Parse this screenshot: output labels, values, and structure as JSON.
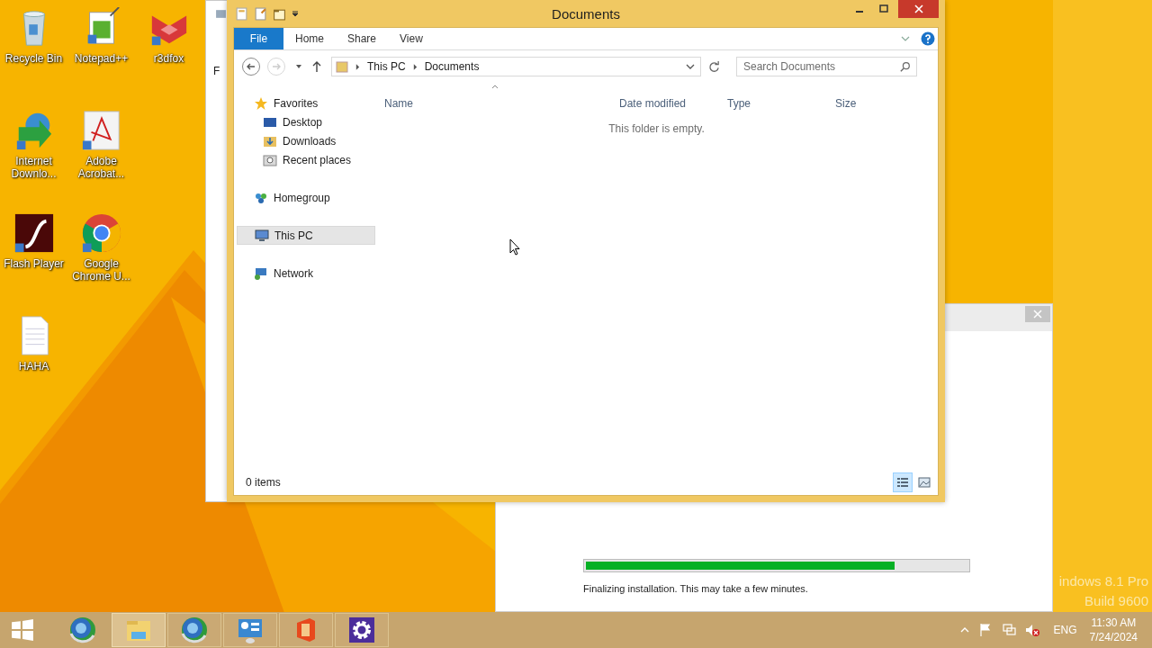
{
  "desktop": {
    "icon_rows": [
      [
        {
          "label": "Recycle Bin",
          "kind": "bin"
        },
        {
          "label": "Notepad++",
          "kind": "notepad"
        },
        {
          "label": "r3dfox",
          "kind": "fox"
        }
      ],
      [
        {
          "label": "Internet Downlo...",
          "kind": "download"
        },
        {
          "label": "Adobe Acrobat...",
          "kind": "pdf"
        }
      ],
      [
        {
          "label": "Flash Player",
          "kind": "flash"
        },
        {
          "label": "Google Chrome U...",
          "kind": "chrome"
        }
      ],
      [
        {
          "label": "HAHA",
          "kind": "file"
        }
      ]
    ],
    "os_label": [
      "indows 8.1 Pro",
      "Build 9600"
    ]
  },
  "background_window": {
    "label": "F"
  },
  "explorer": {
    "title": "Documents",
    "ribbon_tabs": [
      {
        "label": "File",
        "kind": "file"
      },
      {
        "label": "Home",
        "kind": "tab"
      },
      {
        "label": "Share",
        "kind": "tab"
      },
      {
        "label": "View",
        "kind": "tab"
      }
    ],
    "breadcrumb": [
      "This PC",
      "Documents"
    ],
    "search": {
      "placeholder": "Search Documents"
    },
    "nav": [
      {
        "label": "Favorites",
        "kind": "star",
        "selected": false,
        "children": [
          {
            "label": "Desktop",
            "kind": "desktop",
            "selected": false
          },
          {
            "label": "Downloads",
            "kind": "downloads",
            "selected": false
          },
          {
            "label": "Recent places",
            "kind": "recent",
            "selected": false
          }
        ]
      },
      {
        "label": "Homegroup",
        "kind": "homegroup",
        "selected": false
      },
      {
        "label": "This PC",
        "kind": "pc",
        "selected": true
      },
      {
        "label": "Network",
        "kind": "network",
        "selected": false
      }
    ],
    "columns": [
      "Name",
      "Date modified",
      "Type",
      "Size"
    ],
    "empty_message": "This folder is empty.",
    "status": "0 items",
    "views": [
      {
        "kind": "details",
        "selected": true
      },
      {
        "kind": "large",
        "selected": false
      }
    ]
  },
  "installer": {
    "progress": {
      "level": 0.81
    },
    "message": "Finalizing installation. This may take a few minutes."
  },
  "taskbar": {
    "apps": [
      {
        "kind": "globe",
        "running": false,
        "selected": false
      },
      {
        "kind": "folder",
        "running": true,
        "selected": true
      },
      {
        "kind": "globe",
        "running": true,
        "selected": false
      },
      {
        "kind": "panel",
        "running": true,
        "selected": false
      },
      {
        "kind": "office",
        "running": true,
        "selected": false
      },
      {
        "kind": "gear",
        "running": true,
        "selected": false
      }
    ],
    "volume_muted": true,
    "language": "ENG",
    "time": "11:30 AM",
    "date": "7/24/2024"
  }
}
